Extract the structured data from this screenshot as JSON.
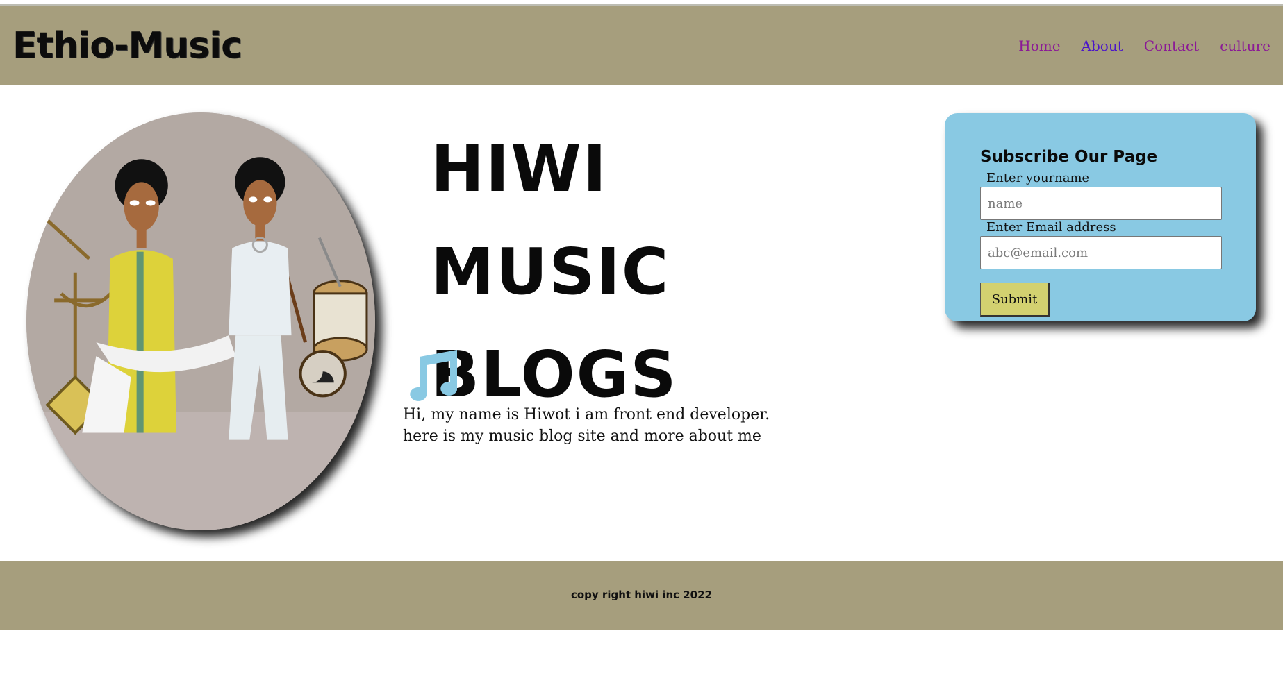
{
  "header": {
    "logo": "Ethio-Music",
    "nav": [
      {
        "label": "Home",
        "color": "#8b1a96"
      },
      {
        "label": "About",
        "color": "#4b16c9"
      },
      {
        "label": "Contact",
        "color": "#8b1a96"
      },
      {
        "label": "culture",
        "color": "#8b1a96"
      }
    ]
  },
  "hero": {
    "title_line1": "HIWI MUSIC",
    "title_line2": "BLOGS",
    "intro_line1": "Hi, my name is Hiwot i am front end developer.",
    "intro_line2": "here is my music blog site and more about me",
    "note_icon_color": "#89c9e3"
  },
  "subscribe": {
    "title": "Subscribe Our Page",
    "name_label": "Enter yourname",
    "name_placeholder": "name",
    "email_label": "Enter Email address",
    "email_placeholder": "abc@email.com",
    "submit_label": "Submit"
  },
  "footer": {
    "copyright": "copy right hiwi inc 2022"
  },
  "colors": {
    "header_bg": "#a69e7d",
    "card_bg": "#89c9e3",
    "button_bg": "#d3d170"
  }
}
